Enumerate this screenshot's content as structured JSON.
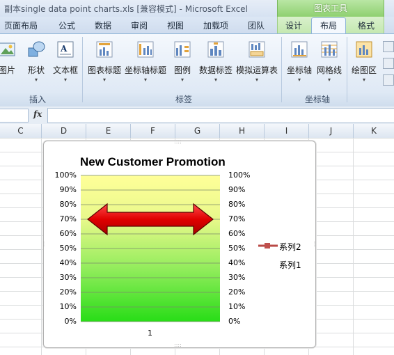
{
  "window": {
    "title": "副本single data point charts.xls  [兼容模式]  -  Microsoft Excel",
    "contextual_group": "图表工具"
  },
  "tabs": [
    {
      "label": "页面布局"
    },
    {
      "label": "公式"
    },
    {
      "label": "数据"
    },
    {
      "label": "审阅"
    },
    {
      "label": "视图"
    },
    {
      "label": "加载项"
    },
    {
      "label": "团队"
    },
    {
      "label": "设计"
    },
    {
      "label": "布局",
      "active": true
    },
    {
      "label": "格式"
    }
  ],
  "ribbon": {
    "insert_group": {
      "label": "插入",
      "buttons": [
        {
          "label": "图片",
          "icon": "picture-icon"
        },
        {
          "label": "形状",
          "icon": "shapes-icon"
        },
        {
          "label": "文本框",
          "icon": "textbox-icon"
        }
      ]
    },
    "labels_group": {
      "label": "标签",
      "buttons": [
        {
          "label": "图表标题",
          "icon": "chart-title-icon"
        },
        {
          "label": "坐标轴标题",
          "icon": "axis-title-icon"
        },
        {
          "label": "图例",
          "icon": "legend-icon"
        },
        {
          "label": "数据标签",
          "icon": "data-labels-icon"
        },
        {
          "label": "模拟运算表",
          "icon": "data-table-icon"
        }
      ]
    },
    "axes_group": {
      "label": "坐标轴",
      "buttons": [
        {
          "label": "坐标轴",
          "icon": "axes-icon"
        },
        {
          "label": "网格线",
          "icon": "gridlines-icon"
        }
      ]
    },
    "background_group": {
      "buttons": [
        {
          "label": "绘图区",
          "icon": "plot-area-icon"
        }
      ]
    }
  },
  "formula_bar": {
    "fx_label": "fx",
    "value": ""
  },
  "columns": [
    "C",
    "D",
    "E",
    "F",
    "G",
    "H",
    "I",
    "J",
    "K"
  ],
  "chart_data": {
    "type": "bar",
    "title": "New Customer Promotion",
    "categories": [
      "1"
    ],
    "y_tick_labels": [
      "100%",
      "90%",
      "80%",
      "70%",
      "60%",
      "50%",
      "40%",
      "30%",
      "20%",
      "10%",
      "0%"
    ],
    "ylim": [
      0,
      1
    ],
    "y2lim": [
      0,
      1
    ],
    "series": [
      {
        "name": "系列2",
        "type": "line",
        "values": [
          0.7
        ],
        "color": "#c0504d",
        "marker": "double-arrow"
      },
      {
        "name": "系列1",
        "type": "bar",
        "values": [
          1.0
        ],
        "gradient": [
          "#ffff99",
          "#28dd17"
        ]
      }
    ],
    "grid": true,
    "legend_position": "right"
  },
  "colors": {
    "contextual_green": "#8fd070",
    "ribbon_blue": "#dfe9f5",
    "arrow_red": "#e00000"
  }
}
